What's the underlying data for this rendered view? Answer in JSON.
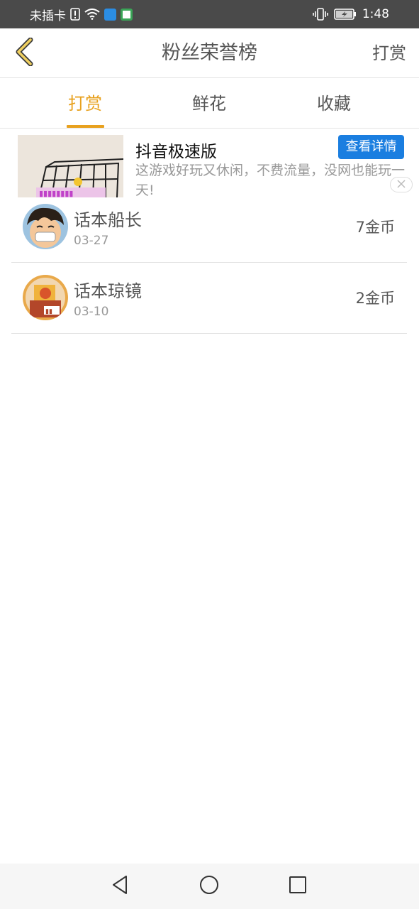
{
  "status_bar": {
    "carrier": "未插卡",
    "time": "1:48",
    "icons": [
      "sim-alert-icon",
      "wifi-icon",
      "app-notification-icon",
      "browser-notification-icon",
      "vibrate-icon",
      "battery-charging-icon"
    ]
  },
  "header": {
    "title": "粉丝荣誉榜",
    "action_label": "打赏",
    "back_icon": "chevron-left-icon",
    "accent_color": "#e8a11e"
  },
  "tabs": {
    "items": [
      {
        "label": "打赏",
        "active": true
      },
      {
        "label": "鲜花",
        "active": false
      },
      {
        "label": "收藏",
        "active": false
      }
    ]
  },
  "ad": {
    "title": "抖音极速版",
    "description": "这游戏好玩又休闲，不费流量，没网也能玩一天!",
    "cta_label": "查看详情",
    "cta_color": "#1a7ee0",
    "close_icon": "close-icon"
  },
  "fans": [
    {
      "name": "话本船长",
      "date": "03-27",
      "amount": "7金币"
    },
    {
      "name": "话本琼镜",
      "date": "03-10",
      "amount": "2金币"
    }
  ],
  "nav_bar": {
    "buttons": [
      "back-triangle-icon",
      "home-circle-icon",
      "recents-square-icon"
    ]
  }
}
